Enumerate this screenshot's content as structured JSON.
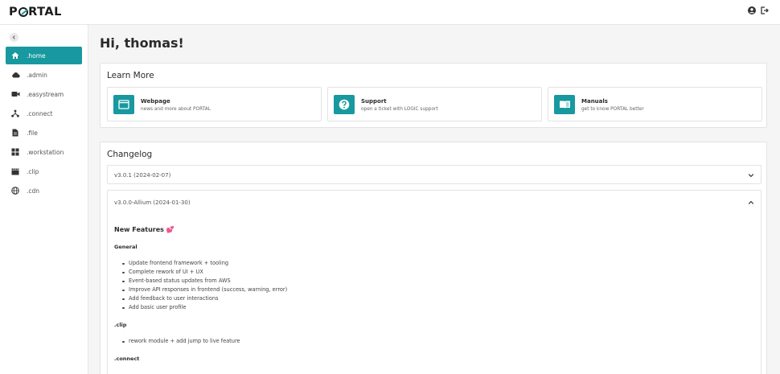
{
  "app": {
    "logo_pre": "P",
    "logo_post": "RTAL"
  },
  "user_greeting": "Hi, thomas!",
  "sidebar": {
    "items": [
      {
        "label": ".home",
        "icon": "home-icon",
        "active": true
      },
      {
        "label": ".admin",
        "icon": "cloud-icon"
      },
      {
        "label": ".easystream",
        "icon": "video-camera-icon"
      },
      {
        "label": ".connect",
        "icon": "network-icon"
      },
      {
        "label": ".file",
        "icon": "file-icon"
      },
      {
        "label": ".workstation",
        "icon": "grid-icon"
      },
      {
        "label": ".clip",
        "icon": "clapperboard-icon"
      },
      {
        "label": ".cdn",
        "icon": "globe-icon"
      }
    ]
  },
  "learn_more": {
    "title": "Learn More",
    "tiles": [
      {
        "title": "Webpage",
        "subtitle": "news and more about PORTAL",
        "icon": "browser-window-icon"
      },
      {
        "title": "Support",
        "subtitle": "open a ticket with LOGIC support",
        "icon": "question-icon"
      },
      {
        "title": "Manuals",
        "subtitle": "get to know PORTAL better",
        "icon": "book-icon"
      }
    ]
  },
  "changelog": {
    "title": "Changelog",
    "entries": [
      {
        "version": "v3.0.1 (2024-02-07)",
        "expanded": false
      },
      {
        "version": "v3.0.0-Allium (2024-01-30)",
        "expanded": true
      }
    ],
    "new_features_title": "New Features 💕",
    "sections": [
      {
        "title": "General",
        "items": [
          "Update frontend framework + tooling",
          "Complete rework of UI + UX",
          "Event-based status updates from AWS",
          "Improve API responses in frontend (success, warning, error)",
          "Add feedback to user interactions",
          "Add basic user profile"
        ]
      },
      {
        "title": ".clip",
        "items": [
          "rework module + add jump to live feature"
        ]
      },
      {
        "title": ".connect",
        "items": []
      }
    ]
  },
  "colors": {
    "accent": "#17999f",
    "background": "#f5f5f5"
  }
}
